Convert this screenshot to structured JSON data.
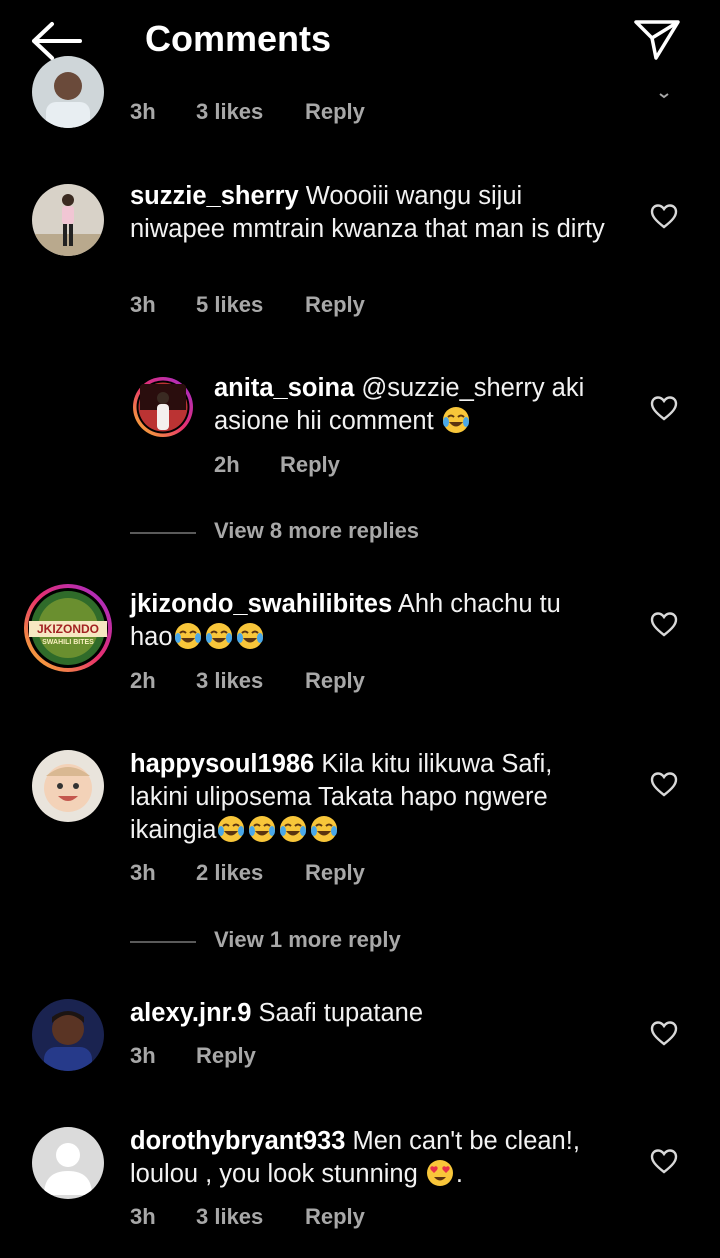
{
  "header": {
    "title": "Comments",
    "back_icon": "arrow-left-icon",
    "share_icon": "paper-plane-icon"
  },
  "colors": {
    "background": "#000000",
    "text": "#f2f2f2",
    "meta": "#a8a8a8",
    "story_ring": [
      "#f9c32b",
      "#e8306d",
      "#9b2bd6"
    ]
  },
  "top_partial": {
    "time": "3h",
    "likes": "3 likes",
    "reply": "Reply"
  },
  "comments": [
    {
      "username": "suzzie_sherry",
      "text": "Woooiii wangu sijui niwapee mmtrain kwanza that man is dirty",
      "time": "3h",
      "likes": "5 likes",
      "reply": "Reply"
    },
    {
      "username": "anita_soina",
      "text": "@suzzie_sherry aki asione hii comment",
      "time": "2h",
      "reply": "Reply",
      "is_reply": true
    },
    {
      "view_more": "View 8 more replies"
    },
    {
      "username": "jkizondo_swahilibites",
      "text": "Ahh chachu tu hao",
      "time": "2h",
      "likes": "3 likes",
      "reply": "Reply",
      "avatar_text": "JKIZONDO",
      "avatar_subtext": "SWAHILI BITES"
    },
    {
      "username": "happysoul1986",
      "text": "Kila kitu ilikuwa Safi, lakini uliposema Takata hapo ngwere ikaingia",
      "time": "3h",
      "likes": "2 likes",
      "reply": "Reply"
    },
    {
      "view_more": "View 1 more reply"
    },
    {
      "username": "alexy.jnr.9",
      "text": "Saafi tupatane",
      "time": "3h",
      "reply": "Reply"
    },
    {
      "username": "dorothybryant933",
      "text": "Men can't be clean!, loulou , you look stunning",
      "text_end": ".",
      "time": "3h",
      "likes": "3 likes",
      "reply": "Reply"
    }
  ]
}
